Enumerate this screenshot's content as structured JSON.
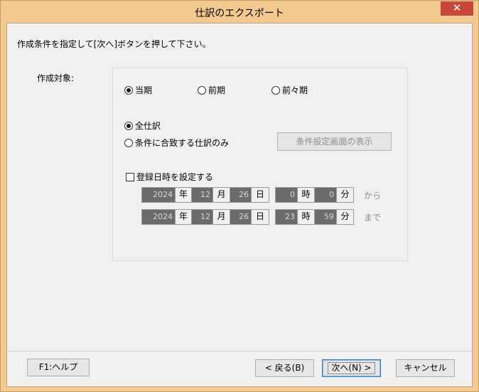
{
  "window": {
    "title": "仕訳のエクスポート",
    "close": "✕"
  },
  "instruction": "作成条件を指定して[次へ]ボタンを押して下さい。",
  "target": {
    "label": "作成対象:",
    "periods": [
      {
        "label": "当期",
        "checked": true
      },
      {
        "label": "前期",
        "checked": false
      },
      {
        "label": "前々期",
        "checked": false
      }
    ],
    "scope": [
      {
        "label": "全仕訳",
        "checked": true
      },
      {
        "label": "条件に合致する仕訳のみ",
        "checked": false
      }
    ],
    "condition_button": "条件設定画面の表示",
    "datetime_checkbox": "登録日時を設定する",
    "datetime_checked": false
  },
  "datetime": {
    "units": {
      "year": "年",
      "month": "月",
      "day": "日",
      "hour": "時",
      "minute": "分"
    },
    "from": {
      "year": "2024",
      "month": "12",
      "day": "26",
      "hour": "0",
      "minute": "0",
      "suffix": "から"
    },
    "to": {
      "year": "2024",
      "month": "12",
      "day": "26",
      "hour": "23",
      "minute": "59",
      "suffix": "まで"
    }
  },
  "buttons": {
    "help": "F1:ヘルプ",
    "back": "< 戻る(B)",
    "next": "次へ(N) >",
    "cancel": "キャンセル"
  }
}
